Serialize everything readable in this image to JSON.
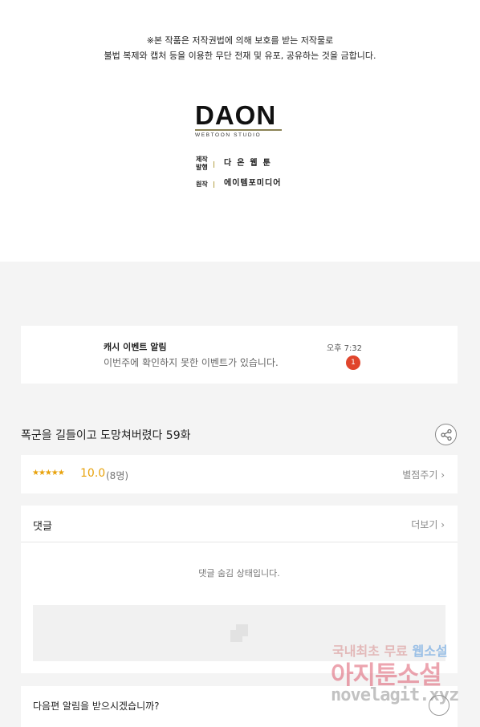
{
  "copyright": {
    "line1": "※본 작품은 저작권법에 의해 보호를 받는 저작물로",
    "line2": "불법 복제와 캡처 등을 이용한 무단 전재 및 유포, 공유하는 것을 금합니다."
  },
  "studio": {
    "logo_text": "DAON",
    "logo_subtext": "WEBTOON STUDIO",
    "credits": [
      {
        "label_top": "제작",
        "label_bottom": "발행",
        "value": "다온웹툰"
      },
      {
        "label_top": "원작",
        "label_bottom": "",
        "value": "에이템포미디어"
      }
    ]
  },
  "notification": {
    "title": "캐시 이벤트 알림",
    "message": "이번주에 확인하지 못한 이벤트가 있습니다.",
    "time": "오후 7:32",
    "badge": "1"
  },
  "episode": {
    "title": "폭군을 길들이고 도망쳐버렸다 59화",
    "share_icon": "share-icon"
  },
  "rating": {
    "stars": "★★★★★",
    "score": "10.0",
    "count": "(8명)",
    "rate_link": "별점주기 ›",
    "star_color": "#e8a20c"
  },
  "comments": {
    "header": "댓글",
    "more_link": "더보기 ›",
    "hidden_message": "댓글 숨김 상태입니다."
  },
  "next_alert": {
    "question": "다음편 알림을 받으시겠습니까?"
  },
  "watermark": {
    "line1_a": "국내최초 무료",
    "line1_b": "웹소설",
    "line2": "아지툰소설",
    "line3": "novelagit.xyz"
  },
  "colors": {
    "accent": "#e8a20c",
    "badge": "#e0452c",
    "background": "#f4f4f4",
    "logo_bar": "#8a8254"
  }
}
